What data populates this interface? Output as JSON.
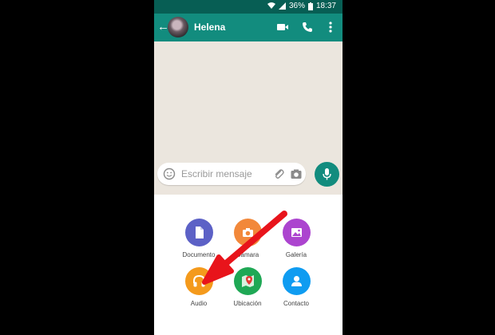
{
  "statusbar": {
    "battery": "36%",
    "time": "18:37"
  },
  "header": {
    "contact_name": "Helena"
  },
  "composer": {
    "placeholder": "Escribir mensaje"
  },
  "attachments": [
    {
      "label": "Documento",
      "color": "#5c61c6",
      "icon": "document-icon"
    },
    {
      "label": "Cámara",
      "color": "#f2883a",
      "icon": "camera-icon"
    },
    {
      "label": "Galería",
      "color": "#ac44cf",
      "icon": "gallery-icon"
    },
    {
      "label": "Audio",
      "color": "#f49a1c",
      "icon": "headphones-icon"
    },
    {
      "label": "Ubicación",
      "color": "#1fa855",
      "icon": "location-icon"
    },
    {
      "label": "Contacto",
      "color": "#0f9cf1",
      "icon": "contact-icon"
    }
  ],
  "colors": {
    "header": "#128c7e",
    "statusbar": "#075e54",
    "arrow": "#e8141b"
  }
}
